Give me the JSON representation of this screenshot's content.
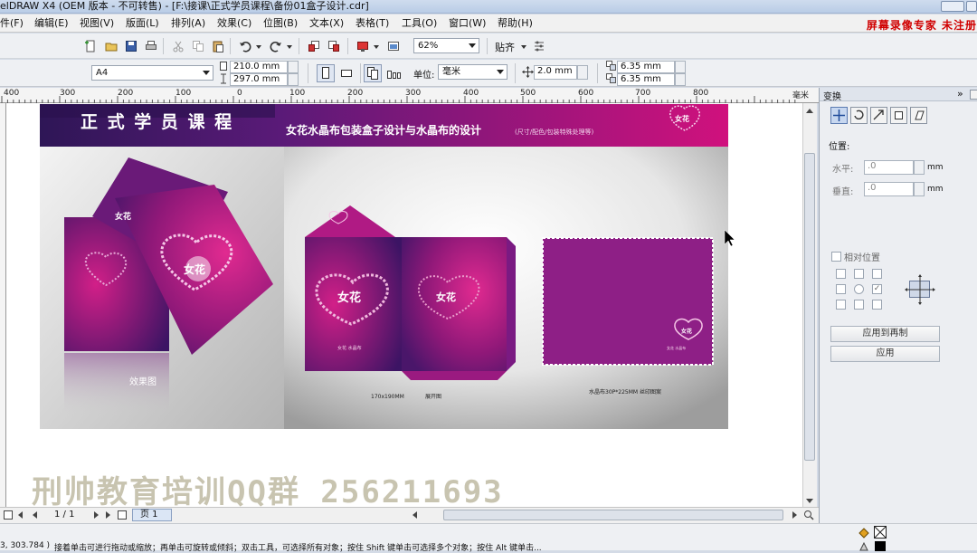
{
  "window": {
    "title": "elDRAW X4 (OEM 版本 - 不可转售) - [F:\\接课\\正式学员课程\\备份01盒子设计.cdr]"
  },
  "menu": [
    "件(F)",
    "编辑(E)",
    "视图(V)",
    "版面(L)",
    "排列(A)",
    "效果(C)",
    "位图(B)",
    "文本(X)",
    "表格(T)",
    "工具(O)",
    "窗口(W)",
    "帮助(H)"
  ],
  "recording_text": "屏幕录像专家  未注册",
  "toolbar": {
    "zoom": "62%",
    "snap_label": "贴齐"
  },
  "property_bar": {
    "paper_size": "A4",
    "width": "210.0 mm",
    "height": "297.0 mm",
    "units_label": "单位:",
    "units_value": "毫米",
    "nudge": "2.0 mm",
    "dup_x": "6.35 mm",
    "dup_y": "6.35 mm"
  },
  "ruler": {
    "ticks": [
      "400",
      "300",
      "200",
      "100",
      "0",
      "100",
      "200",
      "300",
      "400",
      "500",
      "600",
      "700",
      "800",
      "毫米"
    ]
  },
  "artwork": {
    "banner_title": "正 式 学 员 课 程",
    "banner_subtitle": "女花水晶布包装盒子设计与水晶布的设计",
    "banner_note": "(尺寸/配色/包装特殊处理等)",
    "logo_text": "女花",
    "caption_effect": "效果图",
    "caption_size": "170x190MM",
    "caption_unfold": "展开图",
    "caption_cloth": "水晶布30P*225MM  丝印图案",
    "small_print": "女花  水晶布"
  },
  "watermark": "刑帅教育培训QQ群 256211693",
  "page_nav": {
    "counter": "1 / 1",
    "tab": "页 1"
  },
  "status": {
    "coords": "3, 303.784 )",
    "hint": "接着单击可进行拖动或缩放；再单击可旋转或倾斜；双击工具，可选择所有对象；按住 Shift 键单击可选择多个对象；按住 Alt 键单击..."
  },
  "docker": {
    "title": "变换",
    "position_label": "位置:",
    "h_label": "水平:",
    "h_value": ".0",
    "v_label": "垂直:",
    "v_value": ".0",
    "unit": "mm",
    "relative_label": "相对位置",
    "apply_copy": "应用到再制",
    "apply": "应用"
  },
  "colors": {
    "magenta": "#b0187a",
    "purple": "#5a1a6e",
    "banner_dark": "#3a1460",
    "watermark": "#c8c4b0",
    "rec_red": "#d00000"
  }
}
